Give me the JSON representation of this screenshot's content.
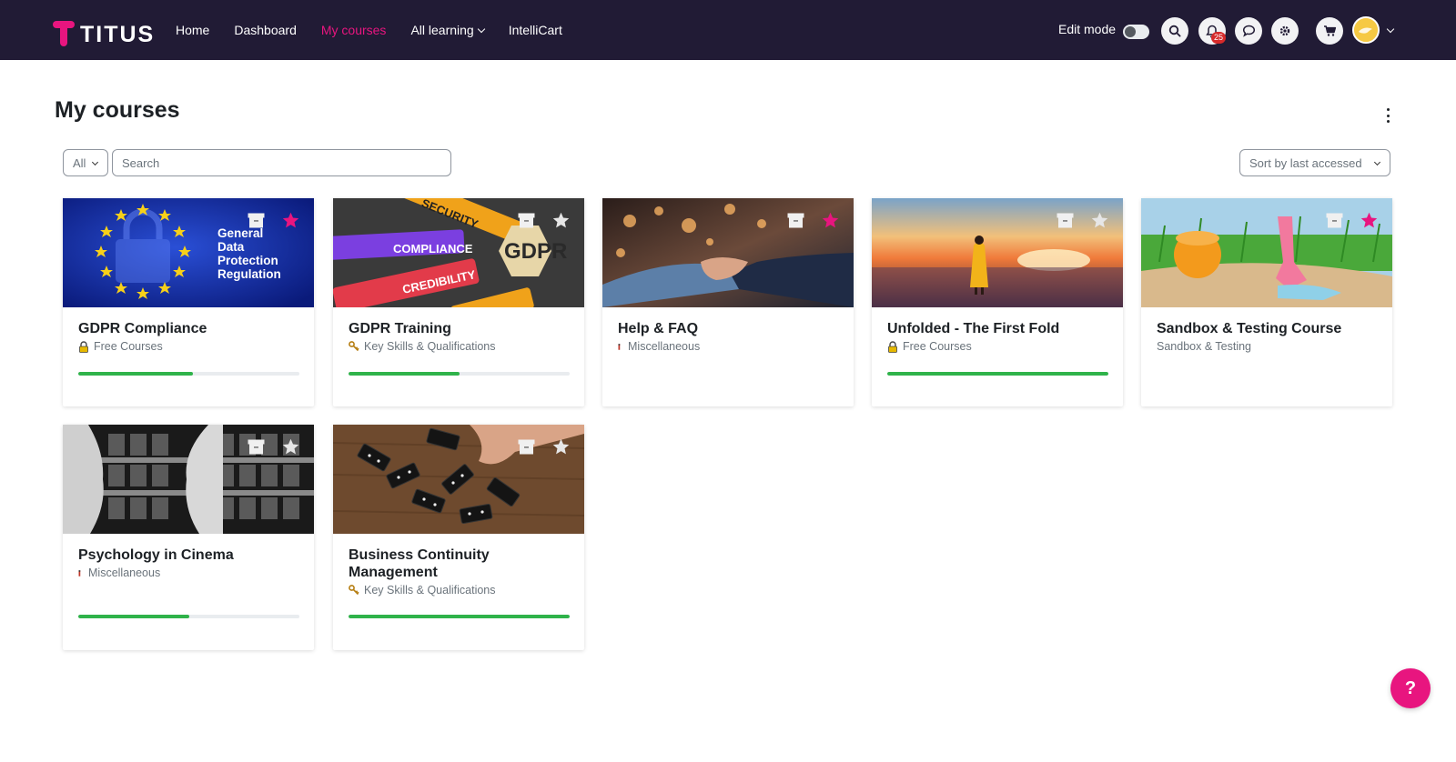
{
  "app": {
    "logo_text": "TITUS",
    "brand_color": "#e8157f",
    "navbar_color": "#211b35"
  },
  "nav": {
    "items": [
      {
        "label": "Home"
      },
      {
        "label": "Dashboard"
      },
      {
        "label": "My courses",
        "active": true
      },
      {
        "label": "All learning",
        "dropdown": true
      },
      {
        "label": "IntelliCart"
      }
    ],
    "edit_mode_label": "Edit mode",
    "notification_count": "25",
    "icons": [
      "search-icon",
      "bell-icon",
      "chat-icon",
      "gear-icon",
      "cart-icon"
    ]
  },
  "page": {
    "title": "My courses",
    "filter_value": "All",
    "search_placeholder": "Search",
    "sort_value": "Sort by last accessed"
  },
  "courses": [
    {
      "name": "GDPR Compliance",
      "category": "Free Courses",
      "category_icon": "lock-icon",
      "progress": 0.52,
      "starred": true,
      "image_text": [
        "General",
        "Data",
        "Protection",
        "Regulation"
      ]
    },
    {
      "name": "GDPR Training",
      "category": "Key Skills & Qualifications",
      "category_icon": "key-icon",
      "progress": 0.5,
      "starred": false,
      "image_text": [
        "SECURITY",
        "COMPLIANCE",
        "GDPR",
        "CREDIBILITY"
      ]
    },
    {
      "name": "Help & FAQ",
      "category": "Miscellaneous",
      "category_icon": "marker-icon",
      "progress": null,
      "starred": true
    },
    {
      "name": "Unfolded - The First Fold",
      "category": "Free Courses",
      "category_icon": "lock-icon",
      "progress": 1.0,
      "starred": false
    },
    {
      "name": "Sandbox & Testing Course",
      "category": "Sandbox & Testing",
      "category_icon": null,
      "progress": null,
      "starred": true
    },
    {
      "name": "Psychology in Cinema",
      "category": "Miscellaneous",
      "category_icon": "marker-icon",
      "progress": 0.5,
      "starred": false
    },
    {
      "name": "Business Continuity Management",
      "category": "Key Skills & Qualifications",
      "category_icon": "key-icon",
      "progress": 1.0,
      "starred": false
    }
  ],
  "help_label": "?"
}
